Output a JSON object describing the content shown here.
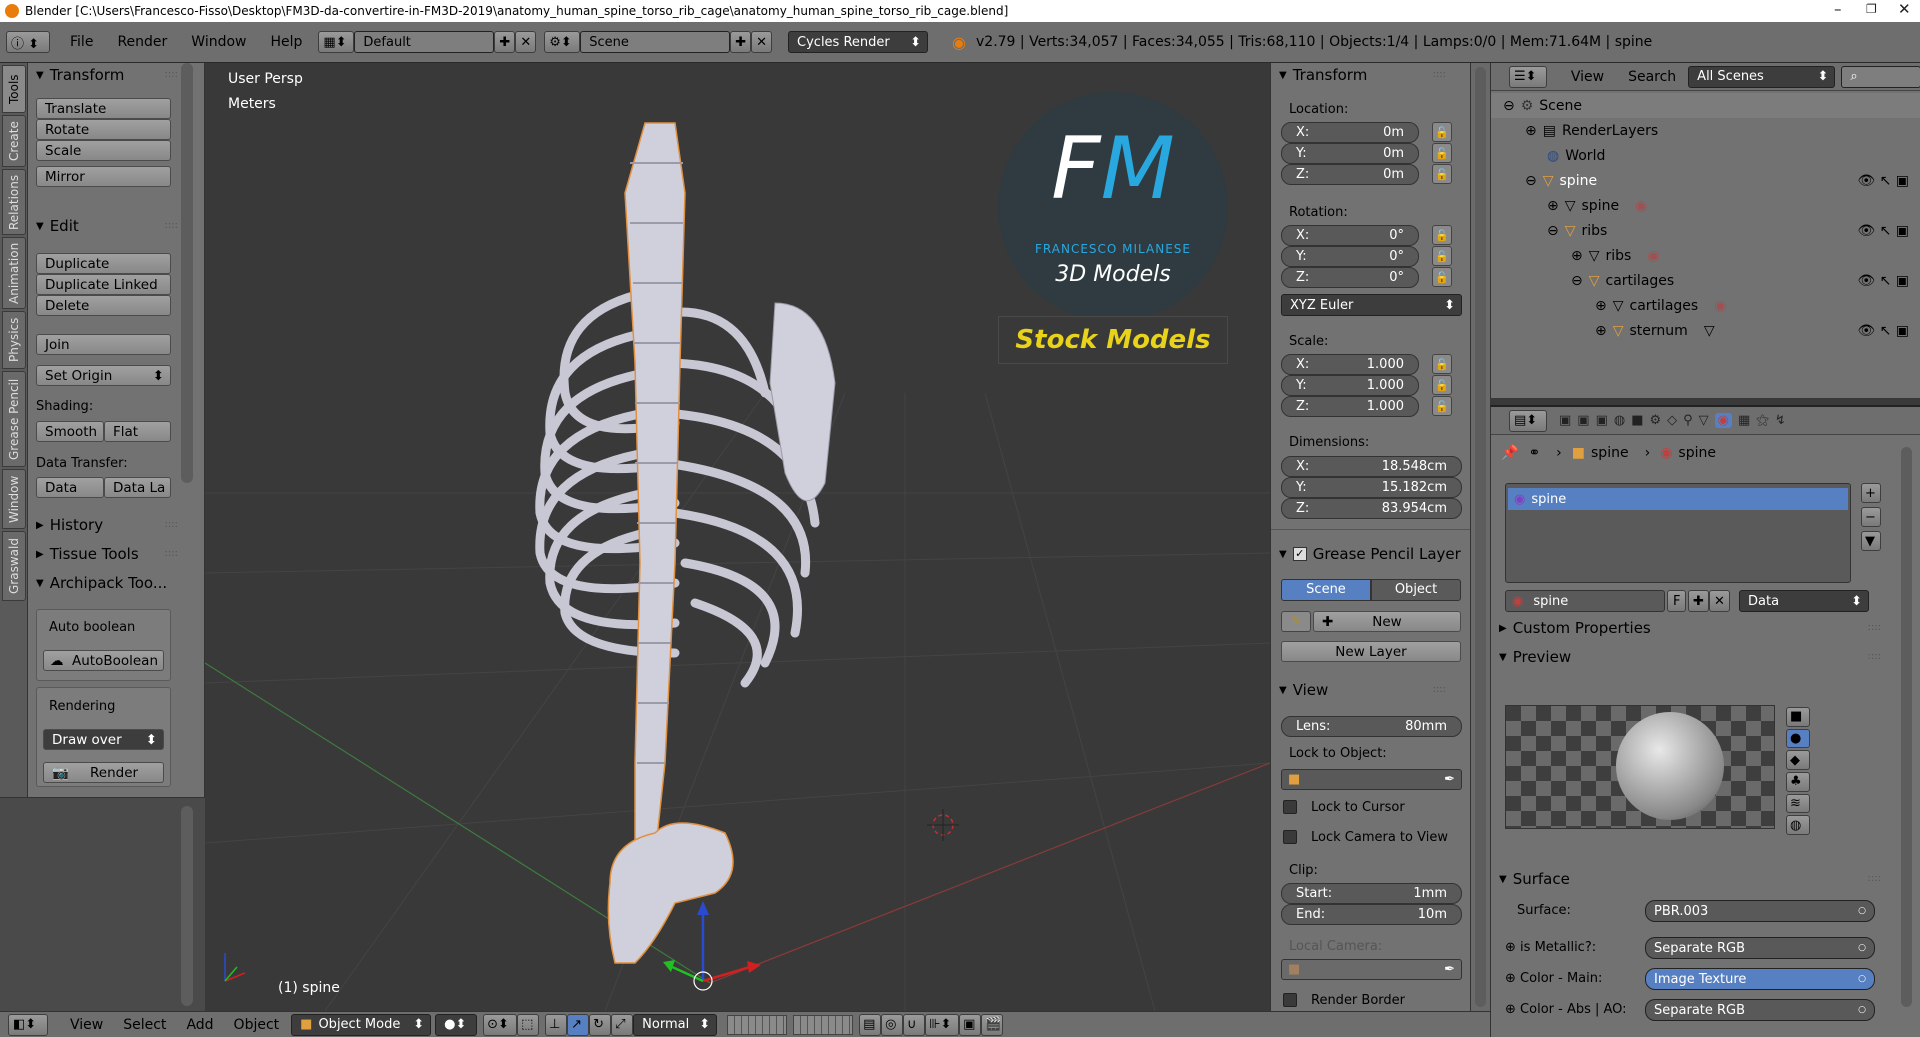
{
  "window": {
    "title": "Blender [C:\\Users\\Francesco-Fisso\\Desktop\\FM3D-da-convertire-in-FM3D-2019\\anatomy_human_spine_torso_rib_cage\\anatomy_human_spine_torso_rib_cage.blend]"
  },
  "infobar": {
    "menus": [
      "File",
      "Render",
      "Window",
      "Help"
    ],
    "layout": "Default",
    "scene": "Scene",
    "engine": "Cycles Render",
    "stats": "v2.79 | Verts:34,057 | Faces:34,055 | Tris:68,110 | Objects:1/4 | Lamps:0/0 | Mem:71.64M | spine"
  },
  "toolshelf": {
    "tabs": [
      "Tools",
      "Create",
      "Relations",
      "Animation",
      "Physics",
      "Grease Pencil",
      "Window",
      "Graswald"
    ],
    "transform_header": "Transform",
    "translate": "Translate",
    "rotate": "Rotate",
    "scale": "Scale",
    "mirror": "Mirror",
    "edit_header": "Edit",
    "duplicate": "Duplicate",
    "duplicate_linked": "Duplicate Linked",
    "delete": "Delete",
    "join": "Join",
    "set_origin": "Set Origin",
    "shading_label": "Shading:",
    "smooth": "Smooth",
    "flat": "Flat",
    "data_transfer_label": "Data Transfer:",
    "data": "Data",
    "data_la": "Data La",
    "history_header": "History",
    "tissue_header": "Tissue Tools",
    "archipack_header": "Archipack Too...",
    "auto_boolean_label": "Auto boolean",
    "auto_boolean_btn": "AutoBoolean",
    "rendering_label": "Rendering",
    "draw_over": "Draw over",
    "render": "Render"
  },
  "viewport": {
    "view_name": "User Persp",
    "units": "Meters",
    "object_label": "(1) spine",
    "logo_fm": "FM",
    "logo_name": "FRANCESCO MILANESE",
    "logo_3d": "3D Models",
    "logo_stock": "Stock Models"
  },
  "npanel": {
    "transform_header": "Transform",
    "location_label": "Location:",
    "loc_x": "0m",
    "loc_y": "0m",
    "loc_z": "0m",
    "rotation_label": "Rotation:",
    "rot_x": "0°",
    "rot_y": "0°",
    "rot_z": "0°",
    "rot_mode": "XYZ Euler",
    "scale_label": "Scale:",
    "scale_x": "1.000",
    "scale_y": "1.000",
    "scale_z": "1.000",
    "dimensions_label": "Dimensions:",
    "dim_x": "18.548cm",
    "dim_y": "15.182cm",
    "dim_z": "83.954cm",
    "gp_header": "Grease Pencil Layer",
    "gp_scene": "Scene",
    "gp_object": "Object",
    "gp_new": "New",
    "gp_new_layer": "New Layer",
    "view_header": "View",
    "lens_label": "Lens:",
    "lens": "80mm",
    "lock_to_object": "Lock to Object:",
    "lock_to_cursor": "Lock to Cursor",
    "lock_camera": "Lock Camera to View",
    "clip_label": "Clip:",
    "clip_start_label": "Start:",
    "clip_start": "1mm",
    "clip_end_label": "End:",
    "clip_end": "10m",
    "local_camera": "Local Camera:",
    "render_border": "Render Border",
    "axis_x": "X:",
    "axis_y": "Y:",
    "axis_z": "Z:"
  },
  "outliner": {
    "view": "View",
    "search": "Search",
    "filter": "All Scenes",
    "rows": [
      "Scene",
      "RenderLayers",
      "World",
      "spine",
      "spine",
      "ribs",
      "ribs",
      "cartilages",
      "cartilages",
      "sternum"
    ]
  },
  "properties": {
    "breadcrumb_obj": "spine",
    "breadcrumb_mat": "spine",
    "slot": "spine",
    "material_name": "spine",
    "material_f": "F",
    "link": "Data",
    "custom_props": "Custom Properties",
    "preview": "Preview",
    "surface_header": "Surface",
    "surface_label": "Surface:",
    "surface_val": "PBR.003",
    "metallic_label": "is Metallic?:",
    "metallic_val": "Separate RGB",
    "color_main_label": "Color - Main:",
    "color_main_val": "Image Texture",
    "color_abs_label": "Color - Abs | AO:",
    "color_abs_val": "Separate RGB"
  },
  "statusbar": {
    "view": "View",
    "select": "Select",
    "add": "Add",
    "object": "Object",
    "mode": "Object Mode",
    "orientation": "Normal"
  },
  "colors": {
    "accent_blue": "#5680c2",
    "logo_blue": "#29a8e0",
    "stock_yellow": "#e8d21a"
  }
}
